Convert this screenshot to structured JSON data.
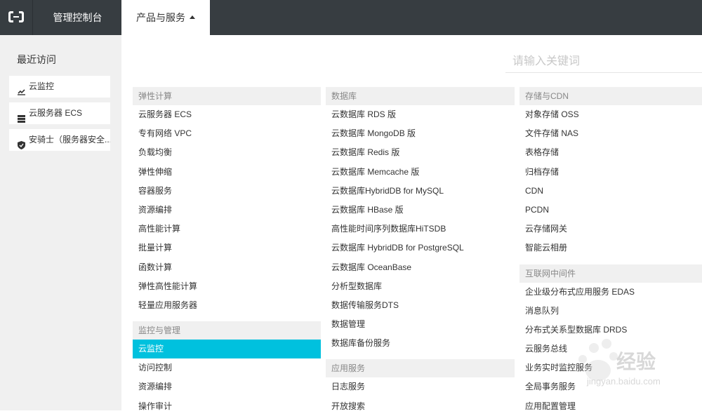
{
  "topbar": {
    "console_label": "管理控制台",
    "products_label": "产品与服务"
  },
  "sidebar": {
    "recent_title": "最近访问",
    "recent": [
      {
        "label": "云监控",
        "icon": "monitor-icon"
      },
      {
        "label": "云服务器 ECS",
        "icon": "server-icon"
      },
      {
        "label": "安骑士（服务器安全...",
        "icon": "shield-icon"
      }
    ]
  },
  "search": {
    "placeholder": "请输入关键词"
  },
  "columns": [
    {
      "groups": [
        {
          "title": "弹性计算",
          "items": [
            "云服务器 ECS",
            "专有网络 VPC",
            "负载均衡",
            "弹性伸缩",
            "容器服务",
            "资源编排",
            "高性能计算",
            "批量计算",
            "函数计算",
            "弹性高性能计算",
            "轻量应用服务器"
          ]
        },
        {
          "title": "监控与管理",
          "items": [
            "云监控",
            "访问控制",
            "资源编排",
            "操作审计"
          ],
          "active": 0
        }
      ]
    },
    {
      "groups": [
        {
          "title": "数据库",
          "items": [
            "云数据库 RDS 版",
            "云数据库 MongoDB 版",
            "云数据库 Redis 版",
            "云数据库 Memcache 版",
            "云数据库HybridDB for MySQL",
            "云数据库 HBase 版",
            "高性能时间序列数据库HiTSDB",
            "云数据库 HybridDB for PostgreSQL",
            "云数据库 OceanBase",
            "分析型数据库",
            "数据传输服务DTS",
            "数据管理",
            "数据库备份服务"
          ]
        },
        {
          "title": "应用服务",
          "items": [
            "日志服务",
            "开放搜索"
          ]
        }
      ]
    },
    {
      "groups": [
        {
          "title": "存储与CDN",
          "items": [
            "对象存储 OSS",
            "文件存储 NAS",
            "表格存储",
            "归档存储",
            "CDN",
            "PCDN",
            "云存储网关",
            "智能云相册"
          ]
        },
        {
          "title": "互联网中间件",
          "items": [
            "企业级分布式应用服务 EDAS",
            "消息队列",
            "分布式关系型数据库 DRDS",
            "云服务总线",
            "业务实时监控服务",
            "全局事务服务",
            "应用配置管理"
          ]
        }
      ]
    }
  ],
  "watermark": {
    "text": "经验",
    "url": "jingyan.baidu.com"
  },
  "colors": {
    "topbar": "#373d41",
    "accent": "#00c1de",
    "sidebar": "#f0f0f0"
  }
}
